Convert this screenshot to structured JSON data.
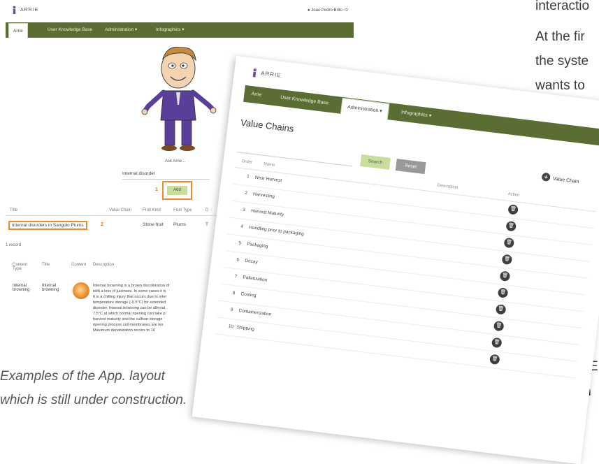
{
  "left_app": {
    "logo": "ARRIE",
    "user": "Joao Pedro Brito",
    "nav": [
      "Arrie",
      "User Knowledge Base",
      "Administration",
      "Infographics"
    ],
    "ask_label": "Ask Arrie...",
    "ask_value": "Internal disorder",
    "annotation_1": "1",
    "annotation_2": "2",
    "add_label": "Add",
    "results_headers": [
      "Title",
      "Value Chain",
      "Fruit Kind",
      "Fruit Type",
      "D"
    ],
    "result_row": {
      "title": "Internal disorders in Sangolo Plums",
      "fruit_kind": "Stone fruit",
      "fruit_type": "Plums",
      "d": "T"
    },
    "found_text": "1 record",
    "content_headers": [
      "Content Type",
      "Title",
      "Content",
      "Description"
    ],
    "content_row": {
      "type": "Internal browning",
      "title": "Internal browning",
      "description_lines": [
        "Internal browning is a brown discoloration of",
        "with a loss of juiciness. In some cases it is",
        "It is a chilling injury that occurs due to inter",
        "temperature storage (-0.5°C) for extended",
        "disorder. Internal browning can be alleviat",
        "7.5°C at which normal ripening can take p",
        "harvest maturity and the cultivar storage",
        "ripening process cell membranes are les",
        "Maximum denaturation occurs to 10"
      ]
    }
  },
  "caption": {
    "line1": "Examples of the App. layout",
    "line2": "which is still under construction."
  },
  "right_text": {
    "line1": "interactio",
    "line2": "At the fir",
    "line3": "the syste",
    "line4": "wants to",
    "line5": "E",
    "line6": "th"
  },
  "tilted_app": {
    "logo": "ARRIE",
    "nav": [
      "Arrie",
      "User Knowledge Base",
      "Administration",
      "Infographics"
    ],
    "title": "Value Chains",
    "search_label": "Search",
    "reset_label": "Reset",
    "add_label": "Value Chain",
    "headers": {
      "order": "Order",
      "name": "Name",
      "description": "Description",
      "action": "Action"
    },
    "rows": [
      {
        "order": "1",
        "name": "Near Harvest"
      },
      {
        "order": "2",
        "name": "Harvesting"
      },
      {
        "order": "3",
        "name": "Harvest Maturity"
      },
      {
        "order": "4",
        "name": "Handling prior to packaging"
      },
      {
        "order": "5",
        "name": "Packaging"
      },
      {
        "order": "6",
        "name": "Decay"
      },
      {
        "order": "7",
        "name": "Palletization"
      },
      {
        "order": "8",
        "name": "Cooling"
      },
      {
        "order": "9",
        "name": "Containerization"
      },
      {
        "order": "10",
        "name": "Shipping"
      }
    ],
    "action_icon": "trash-icon"
  }
}
